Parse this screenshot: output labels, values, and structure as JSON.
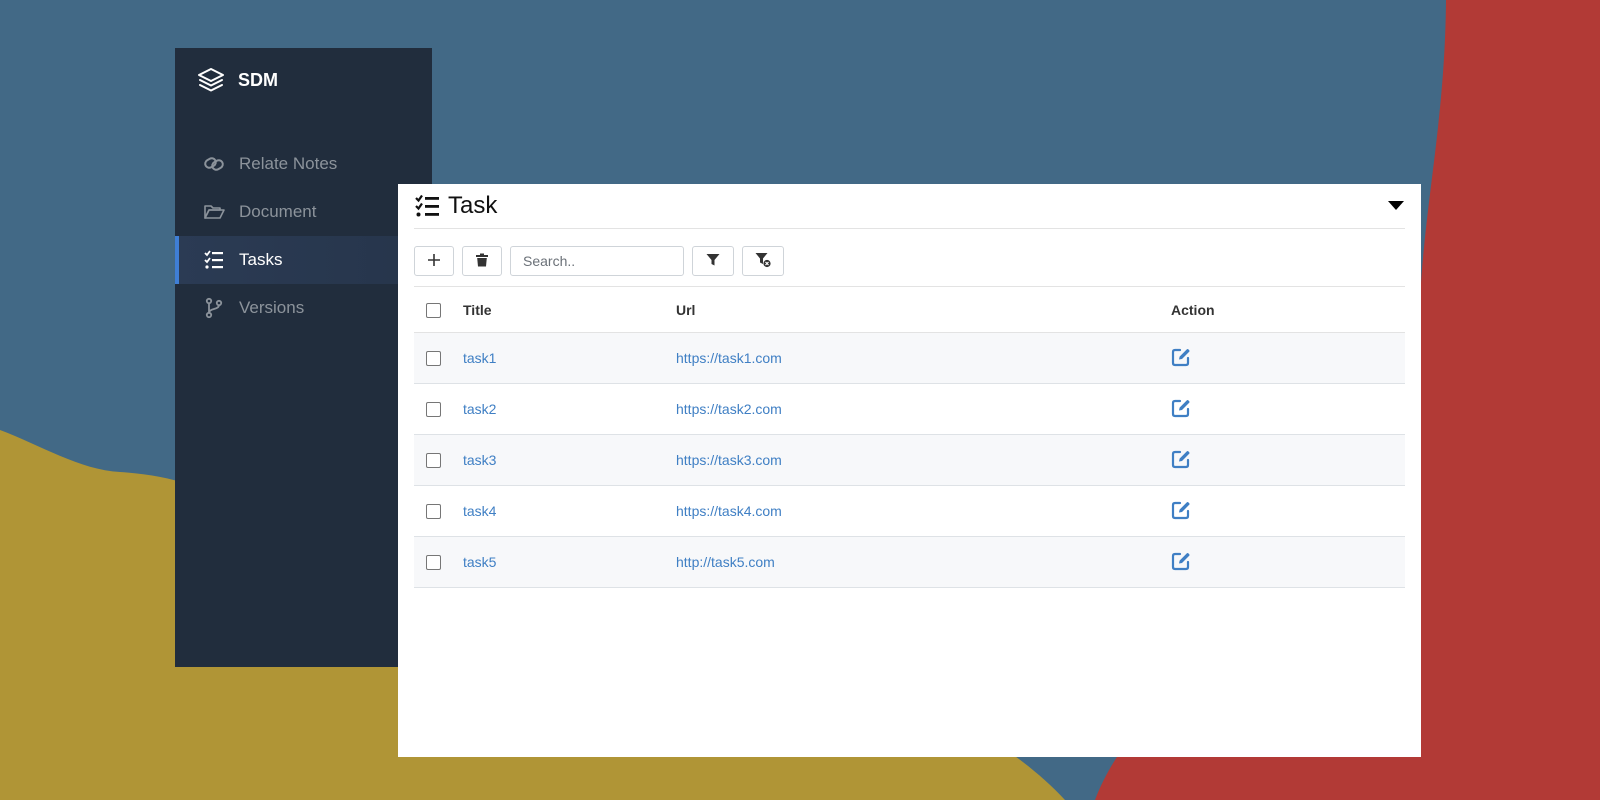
{
  "sidebar": {
    "brand": "SDM",
    "brand_icon": "layers-icon",
    "items": [
      {
        "label": "Relate Notes",
        "icon": "link-icon",
        "active": false
      },
      {
        "label": "Document",
        "icon": "folder-open-icon",
        "active": false
      },
      {
        "label": "Tasks",
        "icon": "tasks-icon",
        "active": true
      },
      {
        "label": "Versions",
        "icon": "code-branch-icon",
        "active": false
      }
    ]
  },
  "panel": {
    "title": "Task",
    "title_icon": "tasks-icon",
    "collapse_icon": "caret-down-icon"
  },
  "toolbar": {
    "add_icon": "plus-icon",
    "delete_icon": "trash-icon",
    "search_placeholder": "Search..",
    "filter_icon": "filter-icon",
    "clear_filter_icon": "filter-clear-icon"
  },
  "table": {
    "columns": [
      "Title",
      "Url",
      "Action"
    ],
    "rows": [
      {
        "title": "task1",
        "url": "https://task1.com"
      },
      {
        "title": "task2",
        "url": "https://task2.com"
      },
      {
        "title": "task3",
        "url": "https://task3.com"
      },
      {
        "title": "task4",
        "url": "https://task4.com"
      },
      {
        "title": "task5",
        "url": "http://task5.com"
      }
    ],
    "action_icon": "edit-icon"
  },
  "colors": {
    "background_blue": "#426986",
    "background_yellow": "#b09536",
    "background_red": "#b23a36",
    "sidebar": "#212d3d",
    "accent": "#3f7fd6",
    "link": "#3f7fc4"
  }
}
